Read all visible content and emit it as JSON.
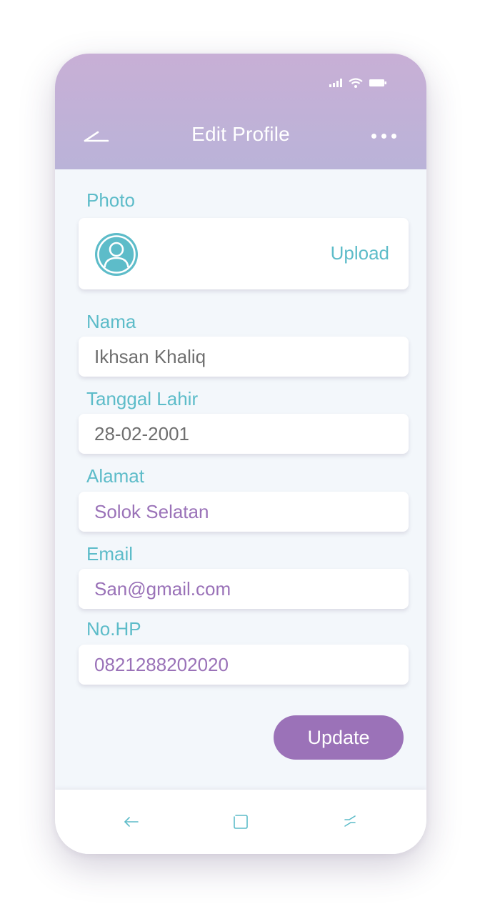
{
  "header": {
    "title": "Edit Profile",
    "back_icon": "back-arrow-icon",
    "menu_icon": "more-dots-icon",
    "status_icons": [
      "signal-icon",
      "wifi-icon",
      "battery-icon"
    ]
  },
  "photo": {
    "label": "Photo",
    "avatar_icon": "user-avatar-icon",
    "upload_label": "Upload"
  },
  "form": {
    "nama": {
      "label": "Nama",
      "value": "Ikhsan Khaliq"
    },
    "tanggal_lahir": {
      "label": "Tanggal Lahir",
      "value": "28-02-2001"
    },
    "alamat": {
      "label": "Alamat",
      "value": "Solok Selatan"
    },
    "email": {
      "label": "Email",
      "value": "San@gmail.com"
    },
    "no_hp": {
      "label": "No.HP",
      "value": "0821288202020"
    }
  },
  "update_label": "Update",
  "navbar": {
    "icons": [
      "nav-back-icon",
      "nav-home-icon",
      "nav-recent-icon"
    ]
  },
  "colors": {
    "header_top": "#c8afd6",
    "header_bottom": "#bab3d8",
    "accent_teal": "#5dbcc9",
    "accent_purple": "#9b72b8",
    "background": "#f3f7fb"
  }
}
